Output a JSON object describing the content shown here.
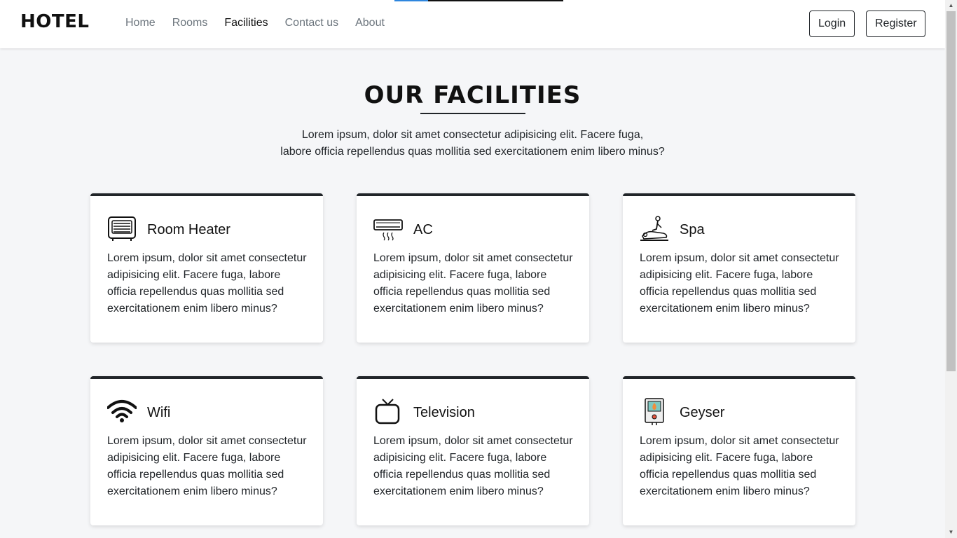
{
  "navbar": {
    "brand": "HOTEL",
    "links": [
      "Home",
      "Rooms",
      "Facilities",
      "Contact us",
      "About"
    ],
    "active": "Facilities",
    "login_label": "Login",
    "register_label": "Register"
  },
  "page": {
    "title": "OUR FACILITIES",
    "intro_line1": "Lorem ipsum, dolor sit amet consectetur adipisicing elit. Facere fuga,",
    "intro_line2": "labore officia repellendus quas mollitia sed exercitationem enim libero minus?"
  },
  "facilities": [
    {
      "title": "Room Heater",
      "icon": "heater-icon",
      "desc": "Lorem ipsum, dolor sit amet consectetur adipisicing elit. Facere fuga, labore officia repellendus quas mollitia sed exercitationem enim libero minus?"
    },
    {
      "title": "AC",
      "icon": "ac-icon",
      "desc": "Lorem ipsum, dolor sit amet consectetur adipisicing elit. Facere fuga, labore officia repellendus quas mollitia sed exercitationem enim libero minus?"
    },
    {
      "title": "Spa",
      "icon": "spa-icon",
      "desc": "Lorem ipsum, dolor sit amet consectetur adipisicing elit. Facere fuga, labore officia repellendus quas mollitia sed exercitationem enim libero minus?"
    },
    {
      "title": "Wifi",
      "icon": "wifi-icon",
      "desc": "Lorem ipsum, dolor sit amet consectetur adipisicing elit. Facere fuga, labore officia repellendus quas mollitia sed exercitationem enim libero minus?"
    },
    {
      "title": "Television",
      "icon": "television-icon",
      "desc": "Lorem ipsum, dolor sit amet consectetur adipisicing elit. Facere fuga, labore officia repellendus quas mollitia sed exercitationem enim libero minus?"
    },
    {
      "title": "Geyser",
      "icon": "geyser-icon",
      "desc": "Lorem ipsum, dolor sit amet consectetur adipisicing elit. Facere fuga, labore officia repellendus quas mollitia sed exercitationem enim libero minus?"
    }
  ],
  "colors": {
    "accent": "#2e86de",
    "card_border": "#212529",
    "background": "#f5f6f8"
  }
}
